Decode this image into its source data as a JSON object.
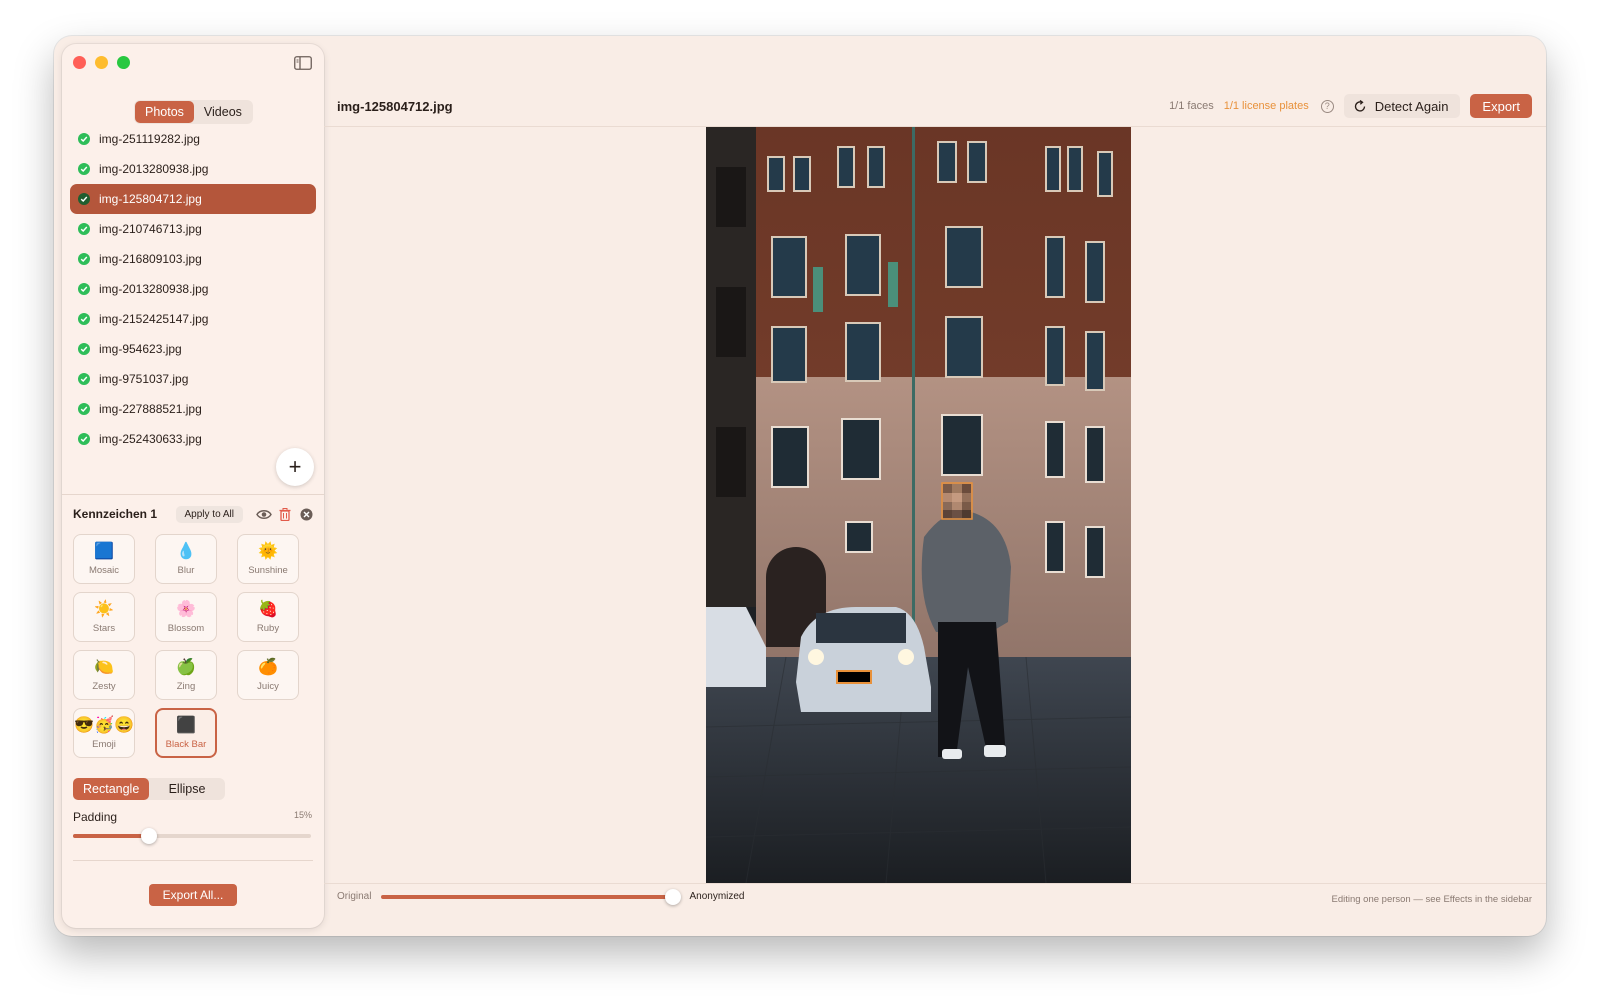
{
  "sidebar": {
    "tabs": [
      {
        "label": "Photos",
        "active": true
      },
      {
        "label": "Videos",
        "active": false
      }
    ],
    "files": [
      {
        "name": "img-251119282.jpg",
        "selected": false
      },
      {
        "name": "img-2013280938.jpg",
        "selected": false
      },
      {
        "name": "img-125804712.jpg",
        "selected": true
      },
      {
        "name": "img-210746713.jpg",
        "selected": false
      },
      {
        "name": "img-216809103.jpg",
        "selected": false
      },
      {
        "name": "img-2013280938.jpg",
        "selected": false
      },
      {
        "name": "img-2152425147.jpg",
        "selected": false
      },
      {
        "name": "img-954623.jpg",
        "selected": false
      },
      {
        "name": "img-9751037.jpg",
        "selected": false
      },
      {
        "name": "img-227888521.jpg",
        "selected": false
      },
      {
        "name": "img-252430633.jpg",
        "selected": false
      }
    ],
    "add_icon": "plus-icon"
  },
  "panel": {
    "title": "Kennzeichen 1",
    "apply_all": "Apply to All",
    "effects": [
      {
        "label": "Mosaic",
        "icon": "🟦",
        "selected": false
      },
      {
        "label": "Blur",
        "icon": "💧",
        "selected": false
      },
      {
        "label": "Sunshine",
        "icon": "🌞",
        "selected": false
      },
      {
        "label": "Stars",
        "icon": "☀️",
        "selected": false
      },
      {
        "label": "Blossom",
        "icon": "🌸",
        "selected": false
      },
      {
        "label": "Ruby",
        "icon": "🍓",
        "selected": false
      },
      {
        "label": "Zesty",
        "icon": "🍋",
        "selected": false
      },
      {
        "label": "Zing",
        "icon": "🍏",
        "selected": false
      },
      {
        "label": "Juicy",
        "icon": "🍊",
        "selected": false
      },
      {
        "label": "Emoji",
        "icon": "😎🥳😄",
        "selected": false
      },
      {
        "label": "Black Bar",
        "icon": "⬛",
        "selected": true
      }
    ],
    "shapes": [
      {
        "label": "Rectangle",
        "active": true
      },
      {
        "label": "Ellipse",
        "active": false
      }
    ],
    "padding_label": "Padding",
    "padding_value": "15%",
    "padding_fraction": 0.32,
    "export_all": "Export All..."
  },
  "main": {
    "filename": "img-125804712.jpg",
    "faces": "1/1 faces",
    "plates": "1/1 license plates",
    "detect_again": "Detect Again",
    "export": "Export",
    "compare_original": "Original",
    "compare_anonymized": "Anonymized",
    "hint": "Editing one person — see Effects in the sidebar"
  },
  "colors": {
    "accent": "#c96345",
    "selected_row": "#b4563b",
    "check_green": "#2ebd59",
    "plates_orange": "#e8913a"
  }
}
